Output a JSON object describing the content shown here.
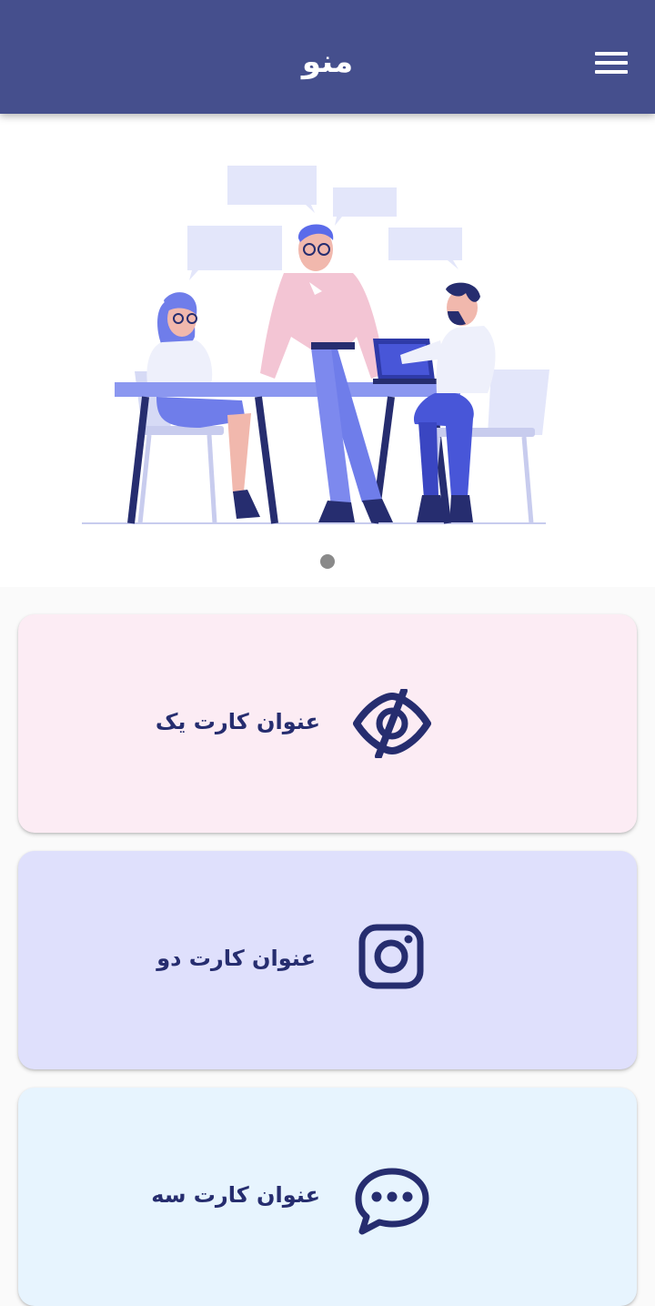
{
  "header": {
    "title": "منو",
    "menu_icon": "hamburger-menu-icon"
  },
  "banner": {
    "illustration": "team-meeting-illustration",
    "pagination": {
      "active_index": 1,
      "total": 1
    }
  },
  "cards": [
    {
      "title": "عنوان کارت یک",
      "icon": "eye-slash-icon",
      "background": "#fcecf4"
    },
    {
      "title": "عنوان کارت دو",
      "icon": "instagram-icon",
      "background": "#dfe0fc"
    },
    {
      "title": "عنوان کارت سه",
      "icon": "chat-bubble-icon",
      "background": "#e7f4fe"
    }
  ],
  "colors": {
    "appbar": "#454f8d",
    "icon": "#262d6f",
    "card_title": "#262d6f"
  }
}
